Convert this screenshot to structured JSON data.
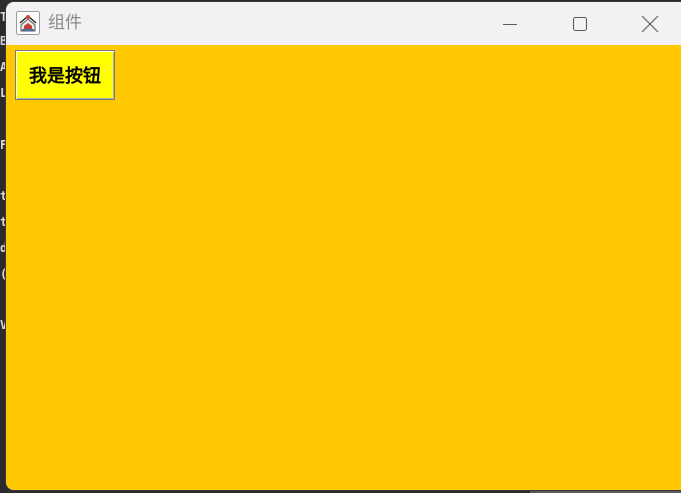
{
  "window": {
    "title": "组件",
    "content_background": "#ffc800"
  },
  "titlebar": {
    "app_icon": "java-coffee-cup-icon",
    "minimize_icon": "minimize-icon",
    "maximize_icon": "maximize-icon",
    "close_icon": "close-icon"
  },
  "content": {
    "button_label": "我是按钮",
    "button_background": "#ffff00"
  },
  "background_window": {
    "left_edge_chars": [
      "T",
      "B",
      "A",
      "L",
      "F",
      "t",
      "t",
      "d",
      "(",
      "V"
    ]
  }
}
